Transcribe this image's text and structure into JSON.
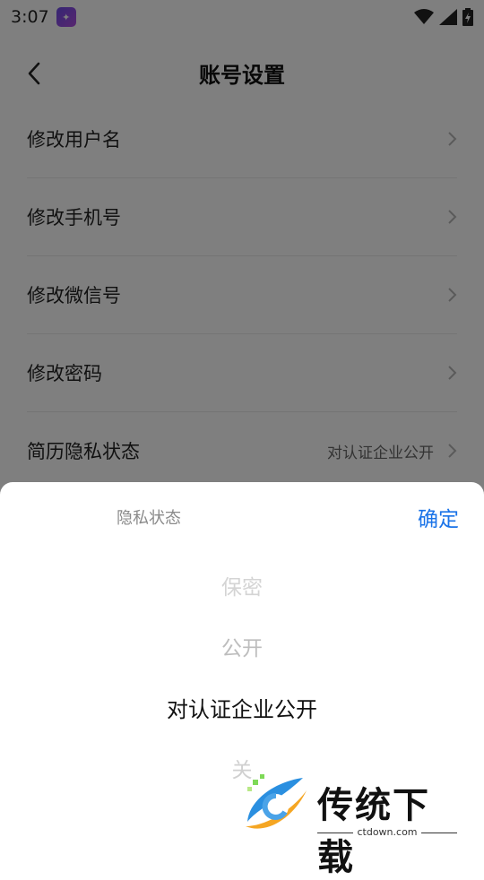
{
  "status_bar": {
    "time": "3:07",
    "app_icon": "app-logo-icon",
    "icons": [
      "wifi-icon",
      "signal-icon",
      "battery-charging-icon"
    ]
  },
  "header": {
    "title": "账号设置",
    "back_icon": "chevron-left-icon"
  },
  "settings": {
    "items": [
      {
        "label": "修改用户名",
        "value": ""
      },
      {
        "label": "修改手机号",
        "value": ""
      },
      {
        "label": "修改微信号",
        "value": ""
      },
      {
        "label": "修改密码",
        "value": ""
      },
      {
        "label": "简历隐私状态",
        "value": "对认证企业公开"
      }
    ]
  },
  "picker_sheet": {
    "title": "隐私状态",
    "confirm_label": "确定",
    "options": [
      "保密",
      "公开",
      "对认证企业公开",
      "关"
    ],
    "selected": "对认证企业公开"
  },
  "watermark": {
    "title": "传统下载",
    "url": "ctdown.com"
  },
  "colors": {
    "accent": "#1a73e8",
    "overlay": "rgba(0,0,0,0.5)"
  }
}
